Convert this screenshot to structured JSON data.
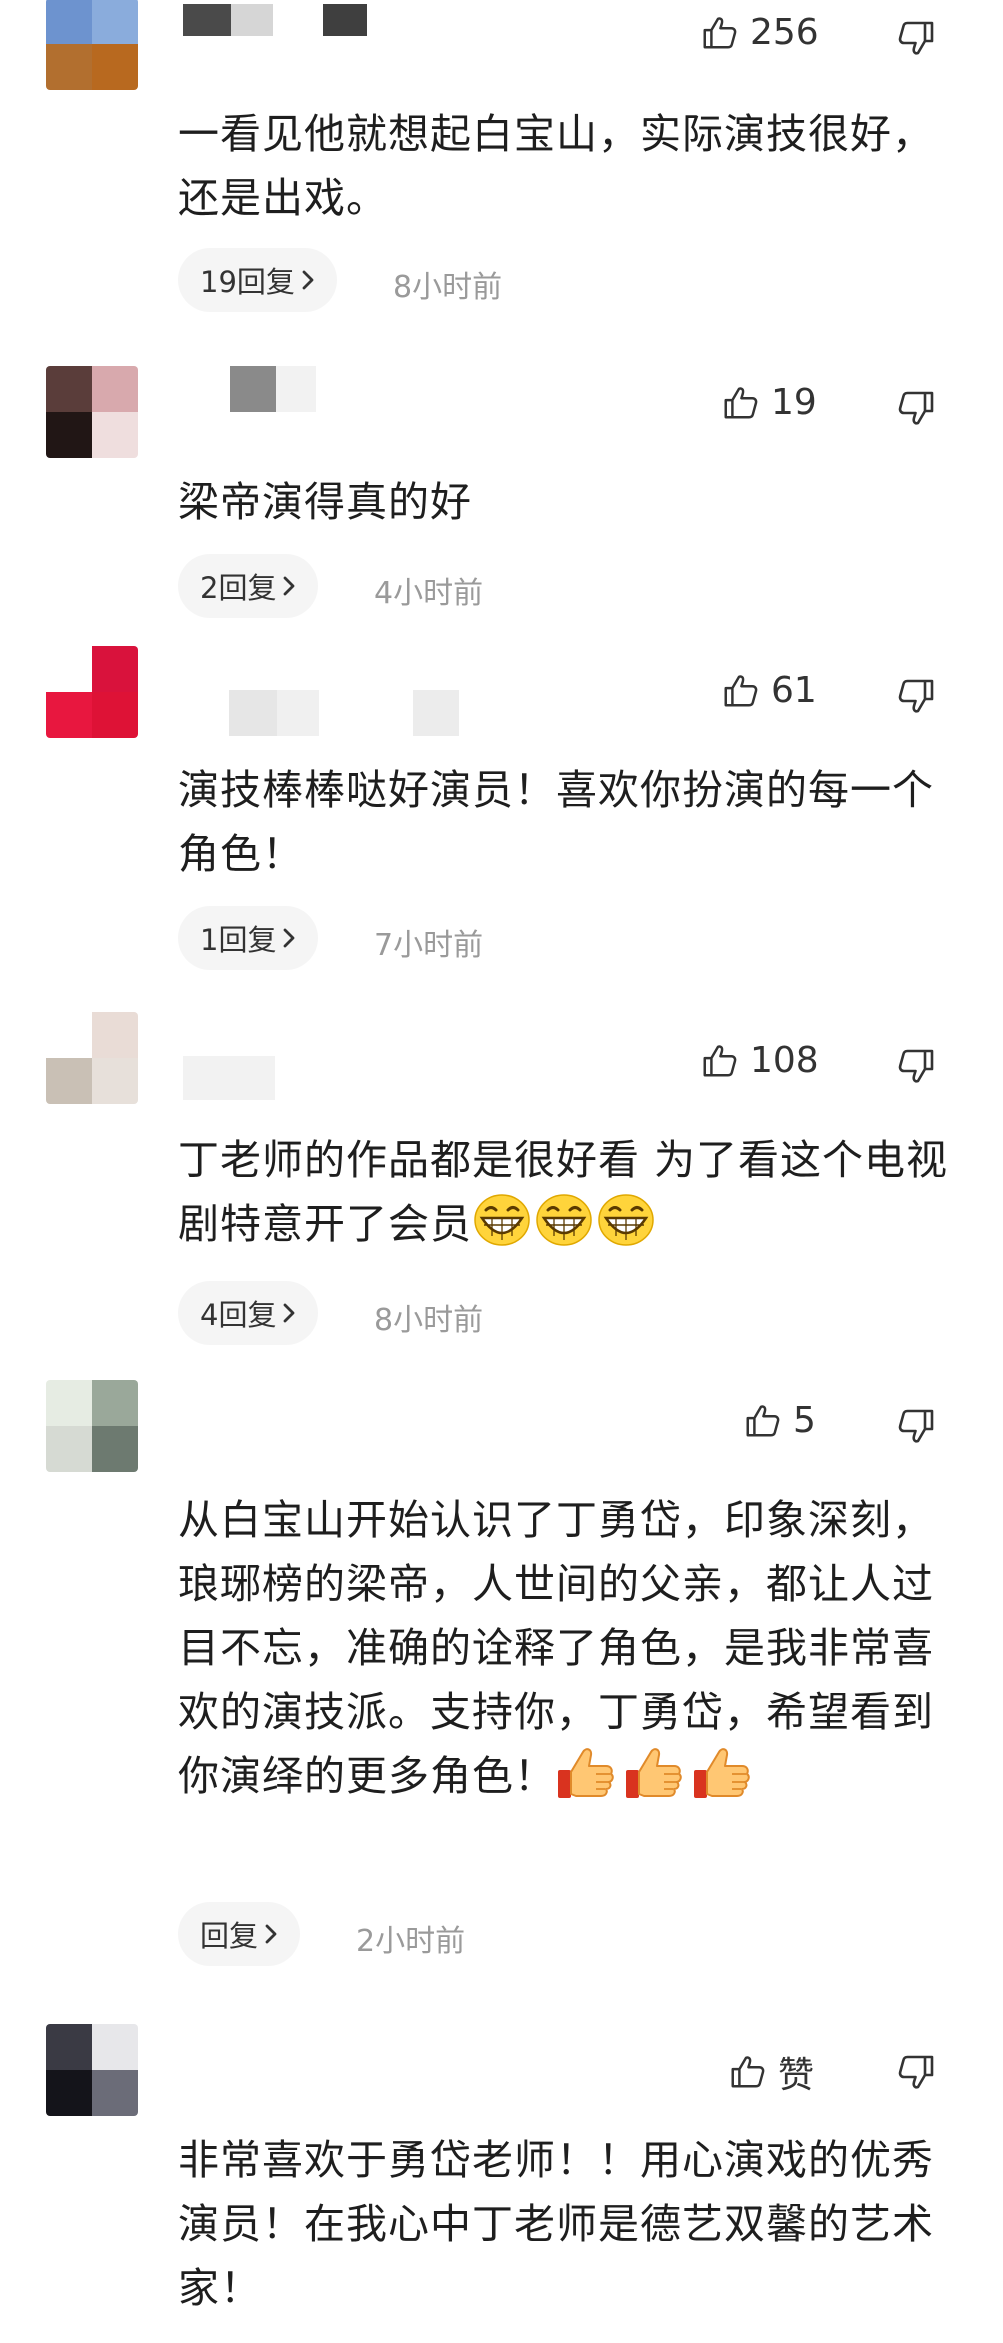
{
  "comments": [
    {
      "likes": "256",
      "text": "一看见他就想起白宝山，实际演技很好，还是出戏。",
      "replies_label": "19回复",
      "time": "8小时前"
    },
    {
      "likes": "19",
      "text": "梁帝演得真的好",
      "replies_label": "2回复",
      "time": "4小时前"
    },
    {
      "likes": "61",
      "text": "演技棒棒哒好演员！喜欢你扮演的每一个角色！",
      "replies_label": "1回复",
      "time": "7小时前"
    },
    {
      "likes": "108",
      "text": "丁老师的作品都是很好看 为了看这个电视剧特意开了会员",
      "replies_label": "4回复",
      "time": "8小时前",
      "emojis": [
        "grin-emoji",
        "grin-emoji",
        "grin-emoji"
      ]
    },
    {
      "likes": "5",
      "text": "从白宝山开始认识了丁勇岱，印象深刻，琅琊榜的梁帝，人世间的父亲，都让人过目不忘，准确的诠释了角色，是我非常喜欢的演技派。支持你，丁勇岱，希望看到你演绎的更多角色！",
      "replies_label": "回复",
      "time": "2小时前",
      "emojis": [
        "thumbs-up-emoji",
        "thumbs-up-emoji",
        "thumbs-up-emoji"
      ]
    },
    {
      "likes": "赞",
      "text": "非常喜欢于勇岱老师！！用心演戏的优秀演员！在我心中丁老师是德艺双馨的艺术家！"
    }
  ],
  "colors": {
    "reply_pill_bg": "#f5f5f5",
    "time_text": "#9a9a9a",
    "body_text": "#1e1e1e"
  },
  "icons": {
    "like": "thumbs-up-outline-icon",
    "dislike": "thumbs-down-outline-icon",
    "chevron": "chevron-right-icon"
  }
}
